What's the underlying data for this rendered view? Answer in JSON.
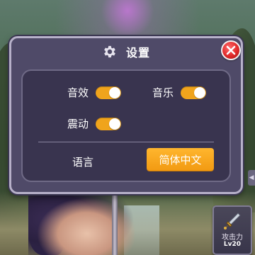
{
  "dialog": {
    "title": "设置",
    "title_icon": "gear-icon",
    "close_icon": "close-icon"
  },
  "settings": {
    "sound_effects": {
      "label": "音效",
      "enabled": true
    },
    "music": {
      "label": "音乐",
      "enabled": true
    },
    "vibration": {
      "label": "震动",
      "enabled": true
    }
  },
  "language": {
    "label": "语言",
    "current": "简体中文"
  },
  "hud": {
    "attack_label": "攻击力",
    "attack_level": "Lv20",
    "attack_icon": "sword-icon",
    "side_tab_icon": "chevron-left-icon"
  },
  "colors": {
    "accent": "#f0a41c",
    "dialog_bg": "#4f4a68",
    "panel_bg": "#39344f",
    "close_red": "#e02a2a"
  }
}
